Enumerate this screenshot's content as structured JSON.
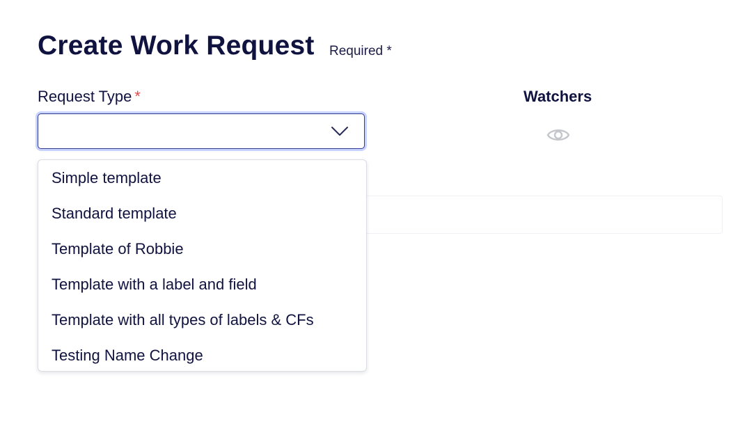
{
  "header": {
    "title": "Create Work Request",
    "required_note": "Required *"
  },
  "request_type": {
    "label": "Request Type",
    "required_marker": "*",
    "value": "",
    "options": [
      "Simple template",
      "Standard template",
      "Template of Robbie",
      "Template with a label and field",
      "Template with all types of labels & CFs",
      "Testing Name Change"
    ]
  },
  "watchers": {
    "label": "Watchers",
    "icon": "eye-icon"
  },
  "colors": {
    "text": "#10123f",
    "focus_border": "#2f3a8f",
    "focus_ring": "#c9d3ff",
    "required_star": "#e04b4b",
    "icon_gray": "#c5c6cc"
  }
}
